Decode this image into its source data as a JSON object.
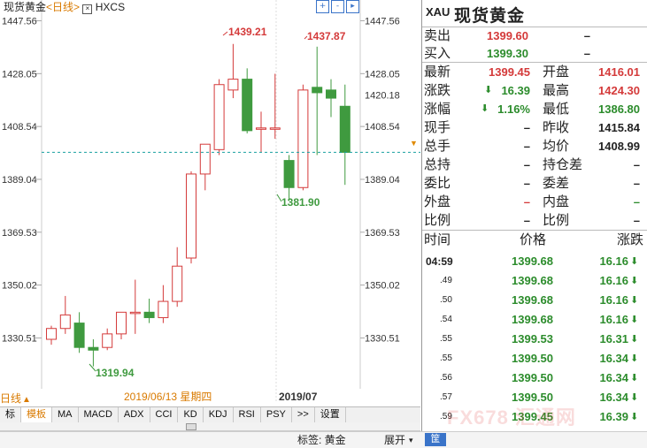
{
  "chart": {
    "title_name": "现货黄金",
    "title_period": "<日线>",
    "title_code": "HXCS",
    "controls": [
      "+",
      "-",
      "▸"
    ],
    "left_axis_ticks": [
      "1447.56",
      "1428.05",
      "1408.54",
      "1389.04",
      "1369.53",
      "1350.02",
      "1330.51"
    ],
    "right_axis_ticks": [
      "1447.56",
      "1428.05",
      "1408.54",
      "1389.04",
      "1369.53",
      "1350.02",
      "1330.51"
    ],
    "current_price_label": "1420.18",
    "annotations": {
      "high1": "1439.21",
      "high2": "1437.87",
      "low1": "1381.90",
      "low2": "1319.94"
    },
    "date_label": "2019/06/13 星期四",
    "month_label": "2019/07",
    "period_label": "日线",
    "colors": {
      "up": "#d43a3a",
      "down": "#3f9a3f",
      "orange": "#e08a00",
      "dash": "#19a0a0"
    }
  },
  "chart_data": {
    "type": "candlestick",
    "ylim": [
      1315,
      1450
    ],
    "candles": [
      {
        "o": 1330,
        "h": 1335,
        "l": 1328,
        "c": 1334
      },
      {
        "o": 1334,
        "h": 1346,
        "l": 1332,
        "c": 1339
      },
      {
        "o": 1336,
        "h": 1340,
        "l": 1325,
        "c": 1327
      },
      {
        "o": 1327,
        "h": 1330,
        "l": 1320,
        "c": 1326
      },
      {
        "o": 1327,
        "h": 1334,
        "l": 1326,
        "c": 1332
      },
      {
        "o": 1332,
        "h": 1340,
        "l": 1330,
        "c": 1340
      },
      {
        "o": 1340,
        "h": 1352,
        "l": 1332,
        "c": 1340
      },
      {
        "o": 1340,
        "h": 1345,
        "l": 1336,
        "c": 1338
      },
      {
        "o": 1338,
        "h": 1350,
        "l": 1336,
        "c": 1344
      },
      {
        "o": 1344,
        "h": 1364,
        "l": 1342,
        "c": 1357
      },
      {
        "o": 1360,
        "h": 1392,
        "l": 1358,
        "c": 1391
      },
      {
        "o": 1391,
        "h": 1402,
        "l": 1385,
        "c": 1402
      },
      {
        "o": 1400,
        "h": 1426,
        "l": 1398,
        "c": 1424
      },
      {
        "o": 1422,
        "h": 1439,
        "l": 1419,
        "c": 1426
      },
      {
        "o": 1426,
        "h": 1430,
        "l": 1406,
        "c": 1407
      },
      {
        "o": 1408,
        "h": 1414,
        "l": 1399,
        "c": 1408
      },
      {
        "o": 1408,
        "h": 1428,
        "l": 1404,
        "c": 1408
      },
      {
        "o": 1396,
        "h": 1398,
        "l": 1381,
        "c": 1386
      },
      {
        "o": 1386,
        "h": 1424,
        "l": 1385,
        "c": 1422
      },
      {
        "o": 1423,
        "h": 1438,
        "l": 1398,
        "c": 1421
      },
      {
        "o": 1422,
        "h": 1426,
        "l": 1412,
        "c": 1419
      },
      {
        "o": 1416,
        "h": 1424,
        "l": 1387,
        "c": 1399
      }
    ]
  },
  "tabs": [
    "标",
    "模板",
    "MA",
    "MACD",
    "ADX",
    "CCI",
    "KD",
    "KDJ",
    "RSI",
    "PSY",
    ">>",
    "设置"
  ],
  "status": {
    "tag": "标签: 黄金",
    "expand": "展开",
    "blue_button": "筐"
  },
  "quote": {
    "code": "XAU",
    "name": "现货黄金",
    "sell": {
      "label": "卖出",
      "value": "1399.60",
      "extra": "–"
    },
    "buy": {
      "label": "买入",
      "value": "1399.30",
      "extra": "–"
    },
    "latest": {
      "label": "最新",
      "value": "1399.45"
    },
    "open": {
      "label": "开盘",
      "value": "1416.01"
    },
    "change": {
      "label": "涨跌",
      "value": "16.39"
    },
    "high": {
      "label": "最高",
      "value": "1424.30"
    },
    "change_pct": {
      "label": "涨幅",
      "value": "1.16%"
    },
    "low": {
      "label": "最低",
      "value": "1386.80"
    },
    "current_vol": {
      "label": "现手",
      "value": "–"
    },
    "prev_close": {
      "label": "昨收",
      "value": "1415.84"
    },
    "total_vol": {
      "label": "总手",
      "value": "–"
    },
    "avg": {
      "label": "均价",
      "value": "1408.99"
    },
    "total_hold": {
      "label": "总持",
      "value": "–"
    },
    "hold_diff": {
      "label": "持仓差",
      "value": "–"
    },
    "commit_ratio": {
      "label": "委比",
      "value": "–"
    },
    "commit_diff": {
      "label": "委差",
      "value": "–"
    },
    "outer": {
      "label": "外盘",
      "value": "–"
    },
    "inner": {
      "label": "内盘",
      "value": "–"
    },
    "ratio1": {
      "label": "比例",
      "value": "–"
    },
    "ratio2": {
      "label": "比例",
      "value": "–"
    },
    "tick_header": {
      "time": "时间",
      "price": "价格",
      "change": "涨跌"
    },
    "ticks": [
      {
        "time": "04:59",
        "price": "1399.68",
        "change": "16.16"
      },
      {
        "time": ".49",
        "price": "1399.68",
        "change": "16.16"
      },
      {
        "time": ".50",
        "price": "1399.68",
        "change": "16.16"
      },
      {
        "time": ".54",
        "price": "1399.68",
        "change": "16.16"
      },
      {
        "time": ".55",
        "price": "1399.53",
        "change": "16.31"
      },
      {
        "time": ".55",
        "price": "1399.50",
        "change": "16.34"
      },
      {
        "time": ".56",
        "price": "1399.50",
        "change": "16.34"
      },
      {
        "time": ".57",
        "price": "1399.50",
        "change": "16.34"
      },
      {
        "time": ".59",
        "price": "1399.45",
        "change": "16.39"
      }
    ]
  },
  "watermark": "FX678 汇通网"
}
